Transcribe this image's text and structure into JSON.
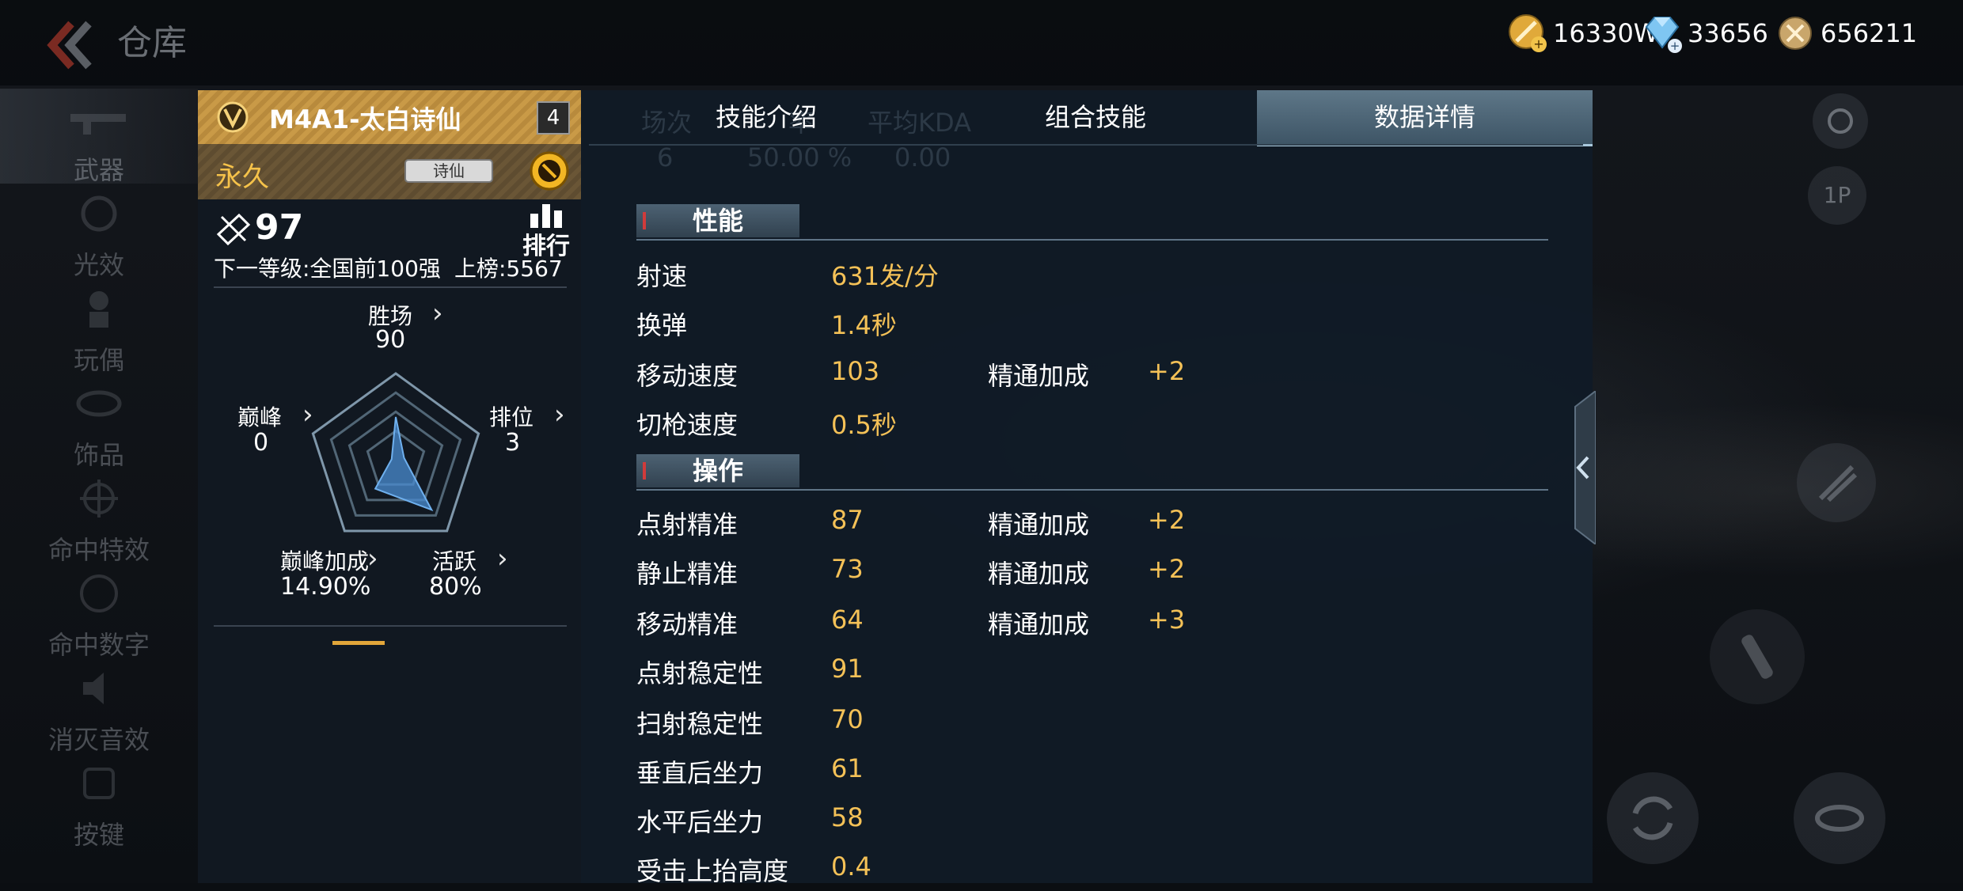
{
  "header": {
    "title": "仓库",
    "currencies": [
      {
        "icon": "gold-coin-icon",
        "value": "16330W"
      },
      {
        "icon": "diamond-icon",
        "value": "33656"
      },
      {
        "icon": "medal-coin-icon",
        "value": "656211"
      }
    ]
  },
  "sidebar": {
    "items": [
      {
        "label": "武器",
        "icon": "rifle-icon"
      },
      {
        "label": "光效",
        "icon": "light-effect-icon"
      },
      {
        "label": "玩偶",
        "icon": "doll-icon"
      },
      {
        "label": "饰品",
        "icon": "ornament-icon"
      },
      {
        "label": "命中特效",
        "icon": "crosshair-icon"
      },
      {
        "label": "命中数字",
        "icon": "hit-number-icon"
      },
      {
        "label": "消灭音效",
        "icon": "sound-icon"
      },
      {
        "label": "按键",
        "icon": "key-icon"
      }
    ],
    "active_index": 0
  },
  "weapon": {
    "name": "M4A1-太白诗仙",
    "level": "4",
    "duration": "永久",
    "badge": "诗仙",
    "score": "97",
    "rank_label": "排行",
    "next_level": "下一等级:全国前100强",
    "ranked": "上榜:5567",
    "stats": {
      "wins_label": "胜场",
      "wins": "90",
      "peak_label": "巅峰",
      "peak": "0",
      "ranked_label": "排位",
      "ranked_val": "3",
      "peak_bonus_label": "巅峰加成",
      "peak_bonus": "14.90%",
      "active_label": "活跃",
      "active": "80%"
    },
    "radar": {
      "wins": 0.5,
      "ranked": 0.1,
      "active": 0.7,
      "peak_bonus": 0.4,
      "peak": 0.05
    }
  },
  "panel": {
    "ghost_headers": [
      "场次",
      "率",
      "平均KDA"
    ],
    "ghost_values": [
      "6",
      "50.00 %",
      "0.00"
    ],
    "tabs": [
      "技能介绍",
      "组合技能",
      "数据详情"
    ],
    "active_tab": 2,
    "sections": [
      {
        "title": "性能",
        "rows": [
          {
            "label": "射速",
            "value": "631发/分",
            "bonus_label": "",
            "bonus": ""
          },
          {
            "label": "换弹",
            "value": "1.4秒",
            "bonus_label": "",
            "bonus": ""
          },
          {
            "label": "移动速度",
            "value": "103",
            "bonus_label": "精通加成",
            "bonus": "+2"
          },
          {
            "label": "切枪速度",
            "value": "0.5秒",
            "bonus_label": "",
            "bonus": ""
          }
        ]
      },
      {
        "title": "操作",
        "rows": [
          {
            "label": "点射精准",
            "value": "87",
            "bonus_label": "精通加成",
            "bonus": "+2"
          },
          {
            "label": "静止精准",
            "value": "73",
            "bonus_label": "精通加成",
            "bonus": "+2"
          },
          {
            "label": "移动精准",
            "value": "64",
            "bonus_label": "精通加成",
            "bonus": "+3"
          },
          {
            "label": "点射稳定性",
            "value": "91",
            "bonus_label": "",
            "bonus": ""
          },
          {
            "label": "扫射稳定性",
            "value": "70",
            "bonus_label": "",
            "bonus": ""
          },
          {
            "label": "垂直后坐力",
            "value": "61",
            "bonus_label": "",
            "bonus": ""
          },
          {
            "label": "水平后坐力",
            "value": "58",
            "bonus_label": "",
            "bonus": ""
          },
          {
            "label": "受击上抬高度",
            "value": "0.4",
            "bonus_label": "",
            "bonus": ""
          }
        ]
      }
    ]
  },
  "colors": {
    "accent_gold": "#f4c157",
    "tab_active": "#4e6678",
    "panel_bg": "#111b26"
  }
}
